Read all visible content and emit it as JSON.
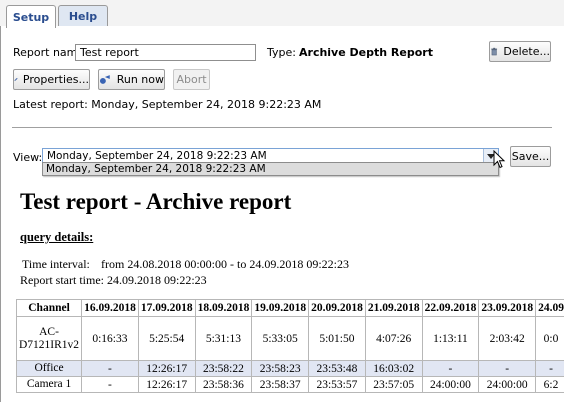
{
  "tabs": [
    {
      "label": "Setup",
      "active": true
    },
    {
      "label": "Help",
      "active": false
    }
  ],
  "form": {
    "report_name_label": "Report name:",
    "report_name_value": "Test report",
    "type_label": "Type:",
    "type_value": "Archive Depth Report",
    "delete_label": "Delete...",
    "properties_label": "Properties...",
    "run_now_label": "Run now",
    "abort_label": "Abort",
    "latest_report": "Latest report: Monday, September 24, 2018 9:22:23 AM"
  },
  "view": {
    "label": "View:",
    "selected": "Monday, September 24, 2018 9:22:23 AM",
    "option": "Monday, September 24, 2018 9:22:23 AM",
    "save_label": "Save..."
  },
  "report": {
    "title": "Test report - Archive report",
    "query_heading": "query details:",
    "time_interval_label": "Time interval:",
    "time_interval_value": "from 24.08.2018 00:00:00 - to 24.09.2018 09:22:23",
    "start_time": "Report start time: 24.09.2018 09:22:23",
    "table": {
      "headers": [
        "Channel",
        "16.09.2018",
        "17.09.2018",
        "18.09.2018",
        "19.09.2018",
        "20.09.2018",
        "21.09.2018",
        "22.09.2018",
        "23.09.2018",
        "24.09"
      ],
      "rows": [
        [
          "AC-D7121IR1v2",
          "0:16:33",
          "5:25:54",
          "5:31:13",
          "5:33:05",
          "5:01:50",
          "4:07:26",
          "1:13:11",
          "2:03:42",
          "0:0"
        ],
        [
          "Office",
          "-",
          "12:26:17",
          "23:58:22",
          "23:58:23",
          "23:53:48",
          "16:03:02",
          "-",
          "-",
          "-"
        ],
        [
          "Camera 1",
          "-",
          "12:26:17",
          "23:58:36",
          "23:58:37",
          "23:53:57",
          "23:57:05",
          "24:00:00",
          "24:00:00",
          "6:2"
        ]
      ]
    }
  },
  "colors": {
    "tab_text": "#2a4d8f",
    "highlight_row": "#e1e6f3",
    "select_border": "#7aa3d6"
  }
}
